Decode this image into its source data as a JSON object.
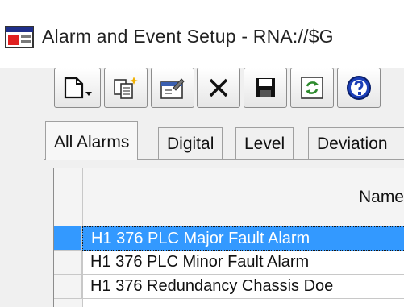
{
  "window": {
    "title": "Alarm and Event Setup - RNA://$G"
  },
  "toolbar": {
    "buttons": [
      {
        "name": "new-button",
        "icon": "new-document-dropdown-icon"
      },
      {
        "name": "copy-button",
        "icon": "copy-sparkle-icon"
      },
      {
        "name": "properties-button",
        "icon": "properties-icon"
      },
      {
        "name": "delete-button",
        "icon": "delete-x-icon"
      },
      {
        "name": "save-button",
        "icon": "floppy-disk-icon"
      },
      {
        "name": "refresh-button",
        "icon": "refresh-icon"
      },
      {
        "name": "help-button",
        "icon": "help-icon"
      }
    ]
  },
  "tabs": [
    {
      "label": "All Alarms",
      "active": true
    },
    {
      "label": "Digital",
      "active": false
    },
    {
      "label": "Level",
      "active": false
    },
    {
      "label": "Deviation",
      "active": false
    }
  ],
  "grid": {
    "columns": [
      {
        "label": "Name"
      }
    ],
    "rows": [
      {
        "name": "H1 376 PLC Major Fault Alarm",
        "selected": true
      },
      {
        "name": "H1 376 PLC Minor Fault Alarm",
        "selected": false
      },
      {
        "name": "H1 376 Redundancy Chassis Doe",
        "selected": false
      }
    ]
  },
  "colors": {
    "selection": "#3399ff",
    "background": "#f0f0f0"
  }
}
